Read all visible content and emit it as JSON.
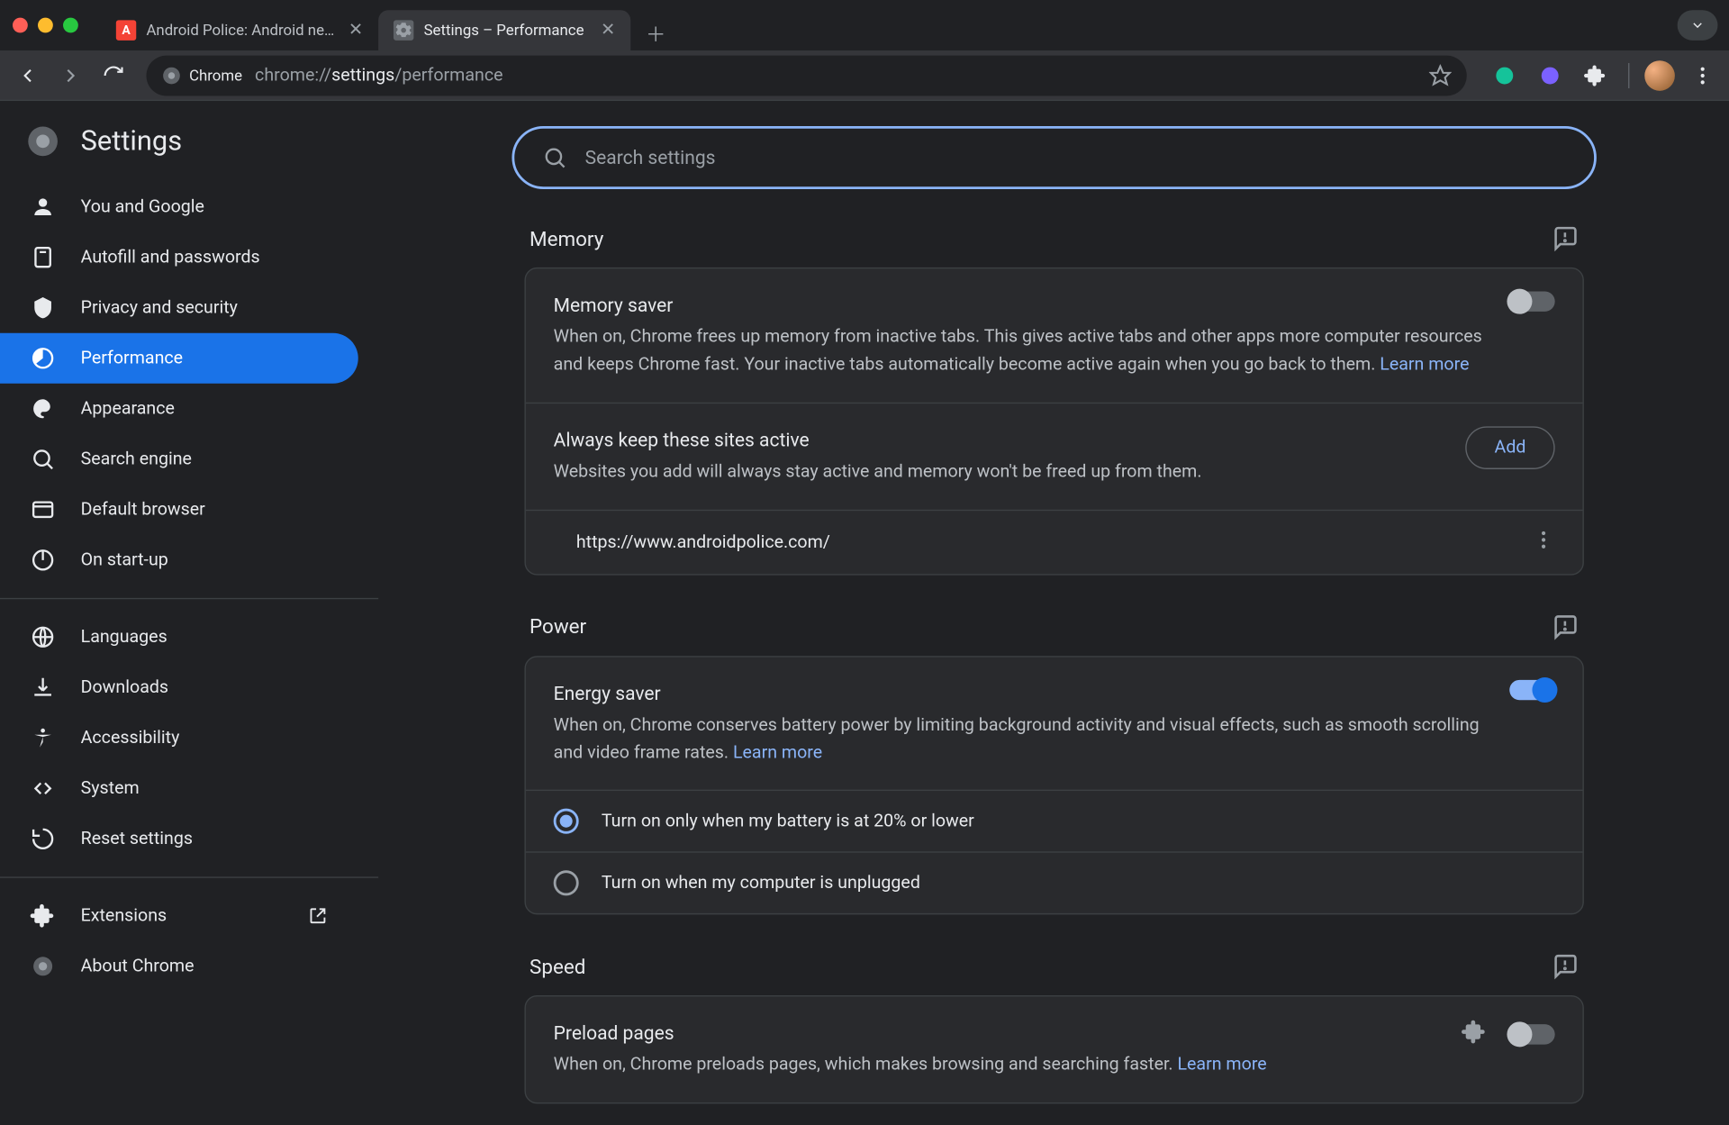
{
  "tabs": [
    {
      "title": "Android Police: Android news",
      "favicon": "AP"
    },
    {
      "title": "Settings – Performance",
      "favicon": "gear"
    }
  ],
  "omnibox": {
    "chip": "Chrome",
    "url_prefix": "chrome://",
    "url_strong": "settings",
    "url_suffix": "/performance"
  },
  "brand": "Settings",
  "search_placeholder": "Search settings",
  "nav": {
    "items": [
      "You and Google",
      "Autofill and passwords",
      "Privacy and security",
      "Performance",
      "Appearance",
      "Search engine",
      "Default browser",
      "On start-up"
    ],
    "items2": [
      "Languages",
      "Downloads",
      "Accessibility",
      "System",
      "Reset settings"
    ],
    "items3": [
      "Extensions",
      "About Chrome"
    ]
  },
  "sections": {
    "memory": {
      "header": "Memory",
      "title": "Memory saver",
      "desc": "When on, Chrome frees up memory from inactive tabs. This gives active tabs and other apps more computer resources and keeps Chrome fast. Your inactive tabs automatically become active again when you go back to them. ",
      "learn": "Learn more",
      "toggle": false,
      "always_title": "Always keep these sites active",
      "always_desc": "Websites you add will always stay active and memory won't be freed up from them.",
      "add": "Add",
      "site": "https://www.androidpolice.com/"
    },
    "power": {
      "header": "Power",
      "title": "Energy saver",
      "desc": "When on, Chrome conserves battery power by limiting background activity and visual effects, such as smooth scrolling and video frame rates. ",
      "learn": "Learn more",
      "toggle": true,
      "radio1": "Turn on only when my battery is at 20% or lower",
      "radio2": "Turn on when my computer is unplugged",
      "selected": 1
    },
    "speed": {
      "header": "Speed",
      "title": "Preload pages",
      "desc": "When on, Chrome preloads pages, which makes browsing and searching faster. ",
      "learn": "Learn more",
      "toggle": false
    }
  }
}
